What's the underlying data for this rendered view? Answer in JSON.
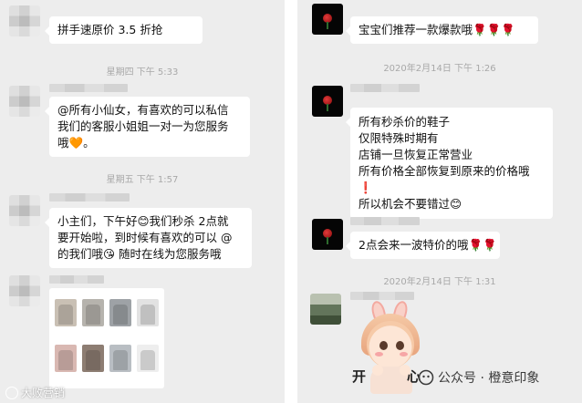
{
  "left_panel": {
    "messages": [
      {
        "text_lines": [
          "拼手速原价 3.5 折抢",
          "🎉🎉🎉"
        ]
      },
      {
        "timestamp": "星期四 下午 5:33"
      },
      {
        "text_lines": [
          "@所有小仙女，有喜欢的可以私信",
          "我们的客服小姐姐一对一为您服务",
          "哦🧡。"
        ]
      },
      {
        "timestamp": "星期五 下午 1:57"
      },
      {
        "text_lines": [
          "小主们，下午好😊我们秒杀 2点就",
          "要开始啦，到时候有喜欢的可以 @",
          "的我们哦😘 随时在线为您服务哦"
        ]
      }
    ]
  },
  "right_panel": {
    "messages": [
      {
        "text_lines": [
          "宝宝们推荐一款爆款哦🌹🌹🌹"
        ]
      },
      {
        "timestamp": "2020年2月14日 下午 1:26"
      },
      {
        "text_lines": [
          "所有秒杀价的鞋子",
          "仅限特殊时期有",
          "店铺一旦恢复正常营业",
          "所有价格全部恢复到原来的价格哦",
          "❗",
          "所以机会不要错过😊"
        ]
      },
      {
        "text_lines": [
          "2点会来一波特价的哦🌹🌹"
        ]
      },
      {
        "timestamp": "2020年2月14日 下午 1:31"
      }
    ],
    "sticker": {
      "left_char": "开",
      "right_char": "心"
    }
  },
  "watermarks": {
    "right": "公众号 · 橙意印象",
    "left": "大败营销"
  },
  "colors": {
    "chat_bg": "#ededed",
    "bubble_bg": "#ffffff",
    "timestamp": "#a8a8a8"
  }
}
